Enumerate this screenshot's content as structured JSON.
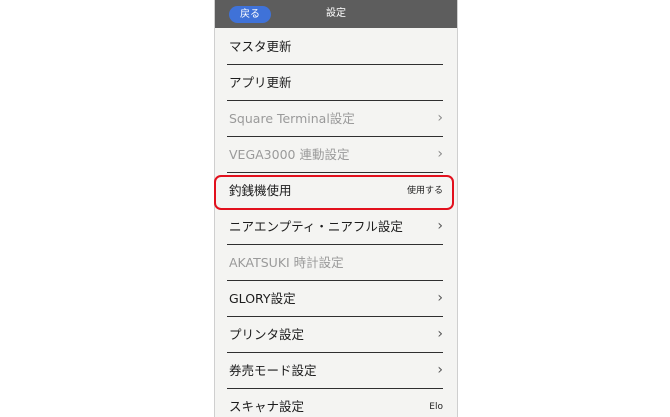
{
  "header": {
    "back_label": "戻る",
    "title": "設定"
  },
  "settings": {
    "items": [
      {
        "label": "マスタ更新",
        "value": "",
        "chevron": false,
        "disabled": false
      },
      {
        "label": "アプリ更新",
        "value": "",
        "chevron": false,
        "disabled": false
      },
      {
        "label": "Square Terminal設定",
        "value": "",
        "chevron": true,
        "disabled": true
      },
      {
        "label": "VEGA3000 連動設定",
        "value": "",
        "chevron": true,
        "disabled": true
      },
      {
        "label": "釣銭機使用",
        "value": "使用する",
        "chevron": false,
        "disabled": false
      },
      {
        "label": "ニアエンプティ・ニアフル設定",
        "value": "",
        "chevron": true,
        "disabled": false
      },
      {
        "label": "AKATSUKI 時計設定",
        "value": "",
        "chevron": false,
        "disabled": true
      },
      {
        "label": "GLORY設定",
        "value": "",
        "chevron": true,
        "disabled": false
      },
      {
        "label": "プリンタ設定",
        "value": "",
        "chevron": true,
        "disabled": false
      },
      {
        "label": "券売モード設定",
        "value": "",
        "chevron": true,
        "disabled": false
      },
      {
        "label": "スキャナ設定",
        "value": "Elo",
        "chevron": false,
        "disabled": false
      }
    ],
    "chevron_glyph": "›"
  },
  "highlight": {
    "color": "#e2101d",
    "target": "釣銭機使用"
  },
  "colors": {
    "header_bg": "#5d5d5d",
    "back_button_bg": "#3f72d8",
    "screen_bg": "#f4f4f2",
    "disabled_text": "#9a9a9a"
  }
}
